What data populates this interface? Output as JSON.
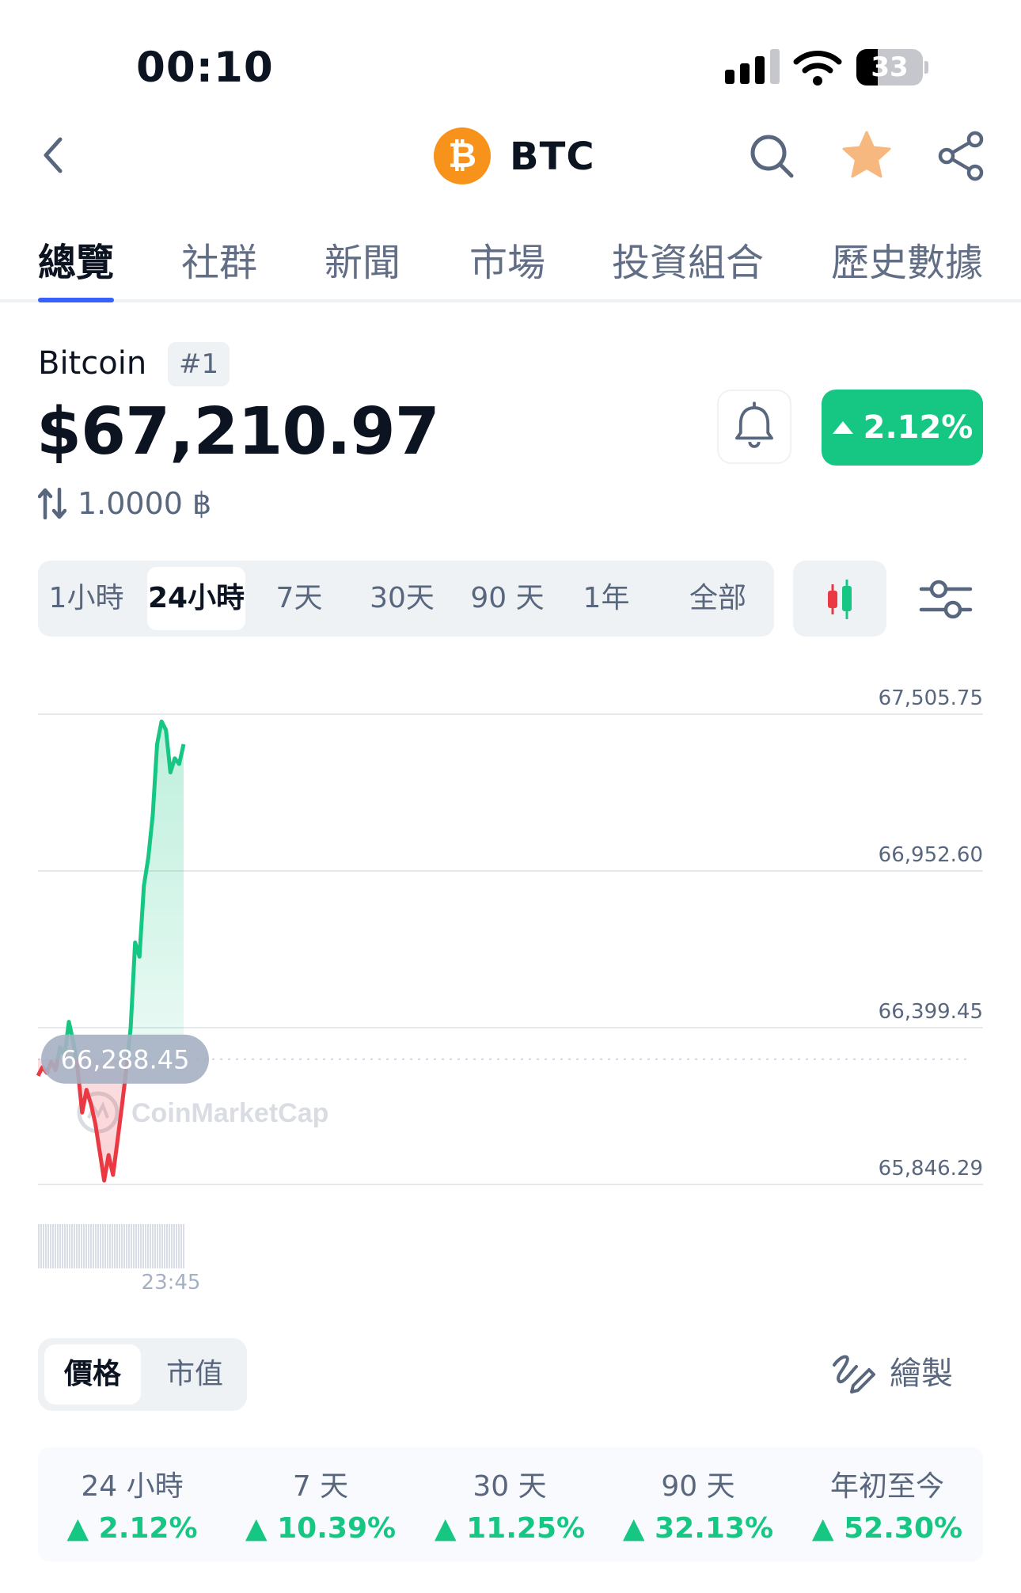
{
  "status_bar": {
    "time": "00:10",
    "battery": "33"
  },
  "header": {
    "symbol": "BTC"
  },
  "tabs": [
    "總覽",
    "社群",
    "新聞",
    "市場",
    "投資組合",
    "歷史數據"
  ],
  "coin": {
    "name": "Bitcoin",
    "rank": "#1",
    "price": "$67,210.97",
    "change_24h": "2.12%",
    "conversion": "1.0000 ฿"
  },
  "time_ranges": [
    "1小時",
    "24小時",
    "7天",
    "30天",
    "90 天",
    "1年",
    "全部"
  ],
  "selected_range": "24小時",
  "colors": {
    "up": "#16c784",
    "down": "#ea3943",
    "accent": "#3861fb",
    "brand_btc": "#f7931a"
  },
  "chart_data": {
    "type": "line",
    "y_ticks": [
      "67,505.75",
      "66,952.60",
      "66,399.45",
      "65,846.29"
    ],
    "ylim": [
      65846.29,
      67505.75
    ],
    "baseline_label": "66,288.45",
    "baseline_value": 66288.45,
    "watermark": "CoinMarketCap",
    "x_ticks": [
      "23:45"
    ],
    "series": [
      {
        "values": [
          66230,
          66260,
          66240,
          66280,
          66250,
          66330,
          66300,
          66420,
          66350,
          66250,
          66100,
          66180,
          66130,
          66060,
          65960,
          65860,
          65950,
          65880,
          66000,
          66120,
          66250,
          66400,
          66700,
          66650,
          66900,
          67000,
          67150,
          67400,
          67480,
          67450,
          67300,
          67350,
          67330,
          67400
        ]
      }
    ]
  },
  "price_toggle": {
    "price": "價格",
    "market_cap": "市值"
  },
  "draw_label": "繪製",
  "stats": [
    {
      "label": "24 小時",
      "value": "2.12%"
    },
    {
      "label": "7 天",
      "value": "10.39%"
    },
    {
      "label": "30 天",
      "value": "11.25%"
    },
    {
      "label": "90 天",
      "value": "32.13%"
    },
    {
      "label": "年初至今",
      "value": "52.30%"
    }
  ]
}
